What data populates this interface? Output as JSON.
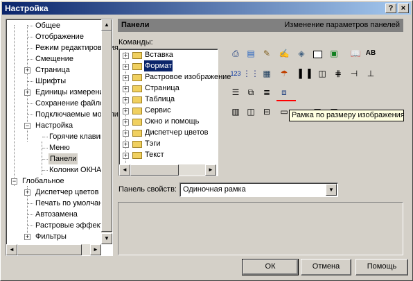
{
  "window": {
    "title": "Настройка",
    "help_btn": "?",
    "close_btn": "×"
  },
  "tree": {
    "items": [
      {
        "label": "Общее"
      },
      {
        "label": "Отображение"
      },
      {
        "label": "Режим редактирования"
      },
      {
        "label": "Смещение"
      },
      {
        "label": "Страница"
      },
      {
        "label": "Шрифты"
      },
      {
        "label": "Единицы измерения"
      },
      {
        "label": "Сохранение файлов"
      },
      {
        "label": "Подключаемые модули"
      },
      {
        "label": "Настройка"
      },
      {
        "label": "Горячие клавиши"
      },
      {
        "label": "Меню"
      },
      {
        "label": "Панели"
      },
      {
        "label": "Колонки ОКНА"
      },
      {
        "label": "Глобальное"
      },
      {
        "label": "Диспетчер цветов"
      },
      {
        "label": "Печать по умолчанию"
      },
      {
        "label": "Автозамена"
      },
      {
        "label": "Растровые эффекты"
      },
      {
        "label": "Фильтры"
      }
    ]
  },
  "panel": {
    "title": "Панели",
    "subtitle": "Изменение параметров панелей"
  },
  "commands": {
    "label": "Команды:",
    "items": [
      {
        "label": "Вставка"
      },
      {
        "label": "Формат"
      },
      {
        "label": "Растровое изображение"
      },
      {
        "label": "Страница"
      },
      {
        "label": "Таблица"
      },
      {
        "label": "Сервис"
      },
      {
        "label": "Окно и помощь"
      },
      {
        "label": "Диспетчер цветов"
      },
      {
        "label": "Тэги"
      },
      {
        "label": "Текст"
      }
    ]
  },
  "tooltip": {
    "text": "Рамка по размеру изображения"
  },
  "properties": {
    "label": "Панель свойств:",
    "value": "Одиночная рамка"
  },
  "buttons": {
    "ok": "ОК",
    "cancel": "Отмена",
    "help": "Помощь"
  },
  "colors": {
    "title_start": "#0a246a",
    "title_end": "#a6caf0",
    "accent": "#ff0000"
  }
}
